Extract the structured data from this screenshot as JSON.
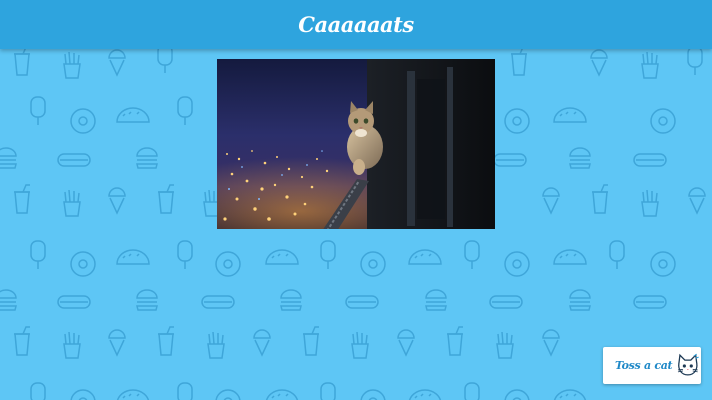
{
  "header": {
    "title": "Caaaaaats"
  },
  "photo": {
    "description_icon": "cat-photo",
    "subject": "cat on balcony railing at night over city"
  },
  "toss_button": {
    "label": "Toss a cat",
    "icon": "cat-face-icon"
  },
  "colors": {
    "background": "#5ec6f5",
    "header": "#2ea4de",
    "pattern_stroke": "#3fa6d9",
    "button_text": "#1e88c7"
  }
}
